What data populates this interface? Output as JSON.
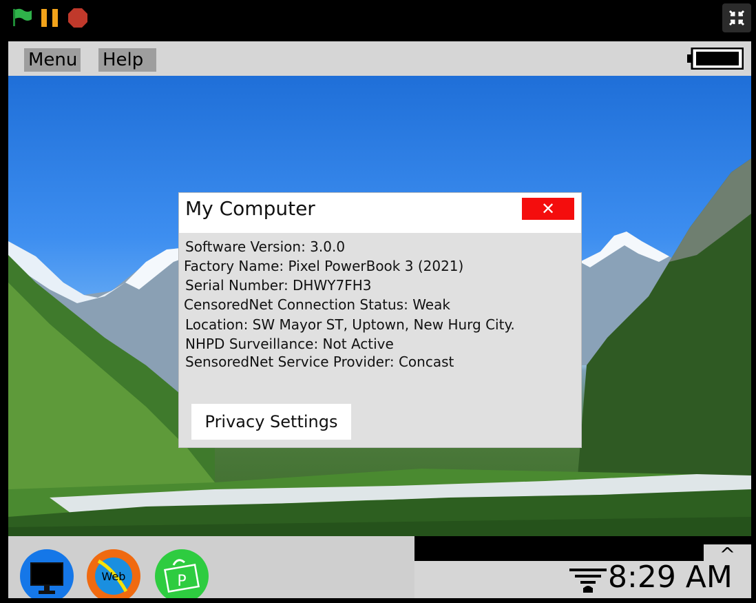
{
  "player": {
    "icons": [
      "green-flag-icon",
      "pause-icon",
      "stop-icon",
      "exit-fullscreen-icon"
    ],
    "colors": {
      "flag": "#2fb24a",
      "pause": "#f2a31a",
      "stop": "#c0392b"
    }
  },
  "menubar": {
    "menu_label": "Menu",
    "help_label": "Help"
  },
  "dialog": {
    "title": "My Computer",
    "close_label": "✕",
    "lines": [
      "Software Version: 3.0.0",
      "Factory Name: Pixel PowerBook 3 (2021)",
      "Serial Number: DHWY7FH3",
      "CensoredNet Connection Status: Weak",
      "Location: SW Mayor ST, Uptown, New Hurg City.",
      "NHPD Surveillance: Not Active",
      "SensoredNet Service Provider: Concast"
    ],
    "privacy_button_label": "Privacy Settings"
  },
  "taskbar": {
    "apps": [
      {
        "name": "my-computer-app",
        "icon": "monitor-icon",
        "label": ""
      },
      {
        "name": "web-browser-app",
        "icon": "web-icon",
        "label": "Web"
      },
      {
        "name": "store-app",
        "icon": "shopping-bag-icon",
        "label": "P"
      }
    ],
    "tray_toggle": "^",
    "clock": "8:29 AM"
  }
}
